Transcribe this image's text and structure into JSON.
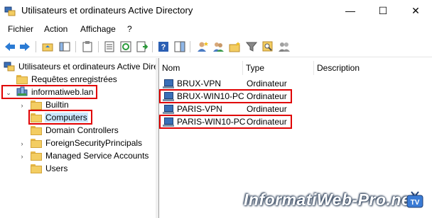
{
  "window": {
    "title": "Utilisateurs et ordinateurs Active Directory",
    "minimize": "—",
    "maximize": "☐",
    "close": "✕"
  },
  "menu": [
    "Fichier",
    "Action",
    "Affichage",
    "?"
  ],
  "tree": {
    "root": "Utilisateurs et ordinateurs Active Directory",
    "saved_queries": "Requêtes enregistrées",
    "domain": "informatiweb.lan",
    "children": [
      "Builtin",
      "Computers",
      "Domain Controllers",
      "ForeignSecurityPrincipals",
      "Managed Service Accounts",
      "Users"
    ]
  },
  "list": {
    "columns": [
      "Nom",
      "Type",
      "Description"
    ],
    "rows": [
      {
        "name": "BRUX-VPN",
        "type": "Ordinateur",
        "highlighted": false
      },
      {
        "name": "BRUX-WIN10-PC",
        "type": "Ordinateur",
        "highlighted": true
      },
      {
        "name": "PARIS-VPN",
        "type": "Ordinateur",
        "highlighted": false
      },
      {
        "name": "PARIS-WIN10-PC",
        "type": "Ordinateur",
        "highlighted": true
      }
    ]
  },
  "watermark": "InformatiWeb-Pro.net",
  "colors": {
    "highlight_box": "#e00000",
    "selection": "#cce8ff"
  }
}
